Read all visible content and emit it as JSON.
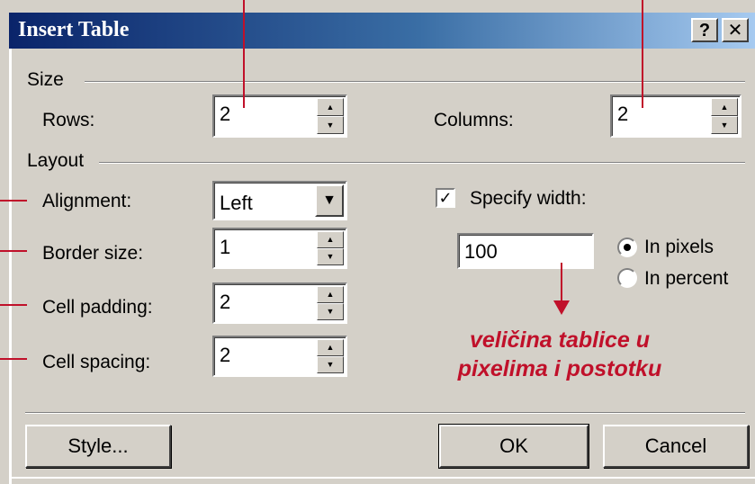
{
  "dialog": {
    "title": "Insert Table",
    "help_button": "?",
    "close_button": "✕"
  },
  "size_group": {
    "label": "Size",
    "rows": {
      "label": "Rows:",
      "value": "2"
    },
    "columns": {
      "label": "Columns:",
      "value": "2"
    }
  },
  "layout_group": {
    "label": "Layout",
    "alignment": {
      "label": "Alignment:",
      "value": "Left"
    },
    "border_size": {
      "label": "Border size:",
      "value": "1"
    },
    "cell_padding": {
      "label": "Cell padding:",
      "value": "2"
    },
    "cell_spacing": {
      "label": "Cell spacing:",
      "value": "2"
    },
    "specify_width": {
      "label": "Specify width:",
      "checked": true,
      "value": "100"
    },
    "unit_options": [
      {
        "label": "In pixels",
        "selected": true
      },
      {
        "label": "In percent",
        "selected": false
      }
    ]
  },
  "buttons": {
    "style": "Style...",
    "ok": "OK",
    "cancel": "Cancel"
  },
  "annotation": {
    "line1": "veličina tablice u",
    "line2": "pixelima i postotku",
    "color": "#c0102a"
  },
  "colors": {
    "dialog_bg": "#d4d0c8",
    "titlebar_start": "#0a246a",
    "titlebar_end": "#a6caf0"
  }
}
